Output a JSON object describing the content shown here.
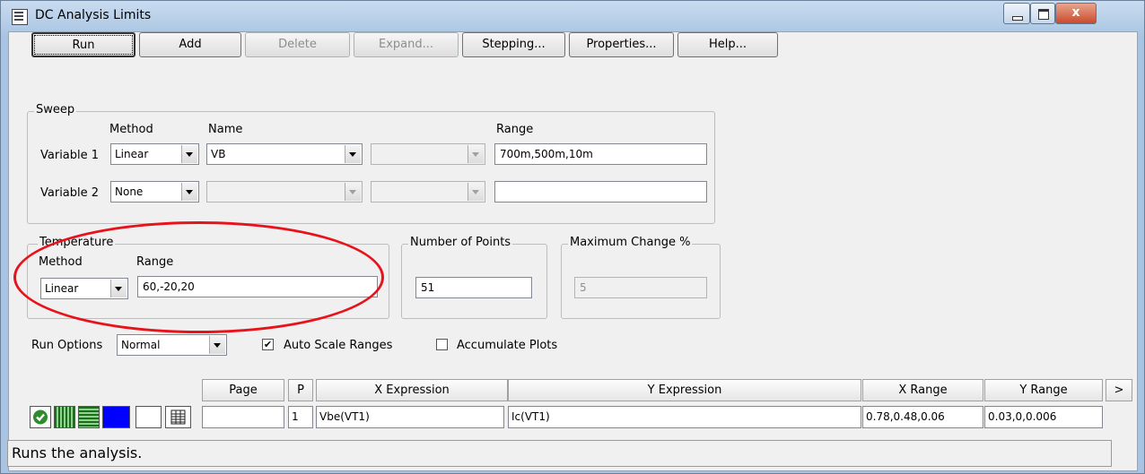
{
  "window": {
    "title": "DC Analysis Limits",
    "close_glyph": "x"
  },
  "toolbar": [
    {
      "label": "Run",
      "disabled": false
    },
    {
      "label": "Add",
      "disabled": false
    },
    {
      "label": "Delete",
      "disabled": true
    },
    {
      "label": "Expand...",
      "disabled": true
    },
    {
      "label": "Stepping...",
      "disabled": false
    },
    {
      "label": "Properties...",
      "disabled": false
    },
    {
      "label": "Help...",
      "disabled": false
    }
  ],
  "sweep": {
    "legend": "Sweep",
    "headers": {
      "method": "Method",
      "name": "Name",
      "range": "Range"
    },
    "variable1": {
      "label": "Variable 1",
      "method": "Linear",
      "name": "VB",
      "name2": "",
      "range": "700m,500m,10m"
    },
    "variable2": {
      "label": "Variable 2",
      "method": "None",
      "name": "",
      "name2": "",
      "range": ""
    }
  },
  "temperature": {
    "legend": "Temperature",
    "method_label": "Method",
    "range_label": "Range",
    "method": "Linear",
    "range": "60,-20,20"
  },
  "points": {
    "legend": "Number of Points",
    "value": "51"
  },
  "max_change": {
    "legend": "Maximum Change %",
    "value": "5"
  },
  "run_options": {
    "label": "Run Options",
    "value": "Normal",
    "auto_scale": "Auto Scale Ranges",
    "auto_scale_checked": true,
    "accumulate": "Accumulate Plots",
    "accumulate_checked": false
  },
  "plot_table": {
    "headers": {
      "page": "Page",
      "p": "P",
      "x_expr": "X Expression",
      "y_expr": "Y Expression",
      "x_range": "X Range",
      "y_range": "Y Range",
      "more": ">"
    },
    "rows": [
      {
        "page": "",
        "p": "1",
        "x_expr": "Vbe(VT1)",
        "y_expr": "Ic(VT1)",
        "x_range": "0.78,0.48,0.06",
        "y_range": "0.03,0,0.006"
      }
    ]
  },
  "status": {
    "text": "Runs the analysis."
  },
  "colors": {
    "annotation": "#e8121b",
    "series_color": "#0000ff",
    "check_icon": "#2e8b2e"
  }
}
